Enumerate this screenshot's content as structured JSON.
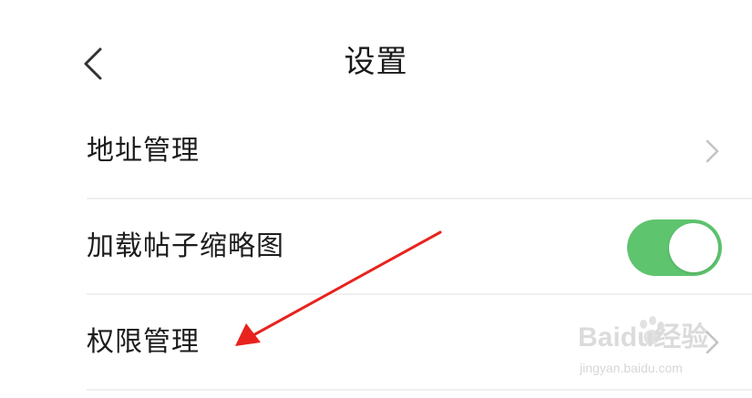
{
  "header": {
    "title": "设置",
    "back_icon": "chevron-left-icon"
  },
  "settings": [
    {
      "label": "地址管理",
      "control": "chevron",
      "icon": "chevron-right-icon"
    },
    {
      "label": "加载帖子缩略图",
      "control": "toggle",
      "toggle_on": true
    },
    {
      "label": "权限管理",
      "control": "chevron",
      "icon": "chevron-right-icon"
    }
  ],
  "watermark": {
    "logo": "Baidu经验",
    "url": "jingyan.baidu.com"
  },
  "colors": {
    "toggle_on": "#5ec46e",
    "annotation_arrow": "#e8231e",
    "chevron": "#c4c4c4",
    "divider": "#f0f0f0"
  }
}
